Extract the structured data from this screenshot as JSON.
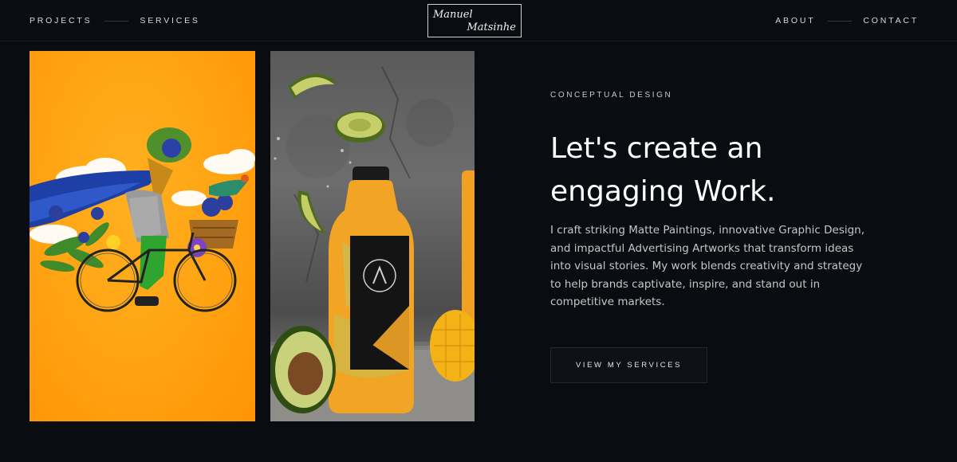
{
  "nav": {
    "left": [
      {
        "label": "PROJECTS"
      },
      {
        "label": "SERVICES"
      }
    ],
    "right": [
      {
        "label": "ABOUT"
      },
      {
        "label": "CONTACT"
      }
    ]
  },
  "logo": {
    "line1": "Manuel",
    "line2": "Matsinhe"
  },
  "gallery": {
    "image1": "illustration-cyclist-with-flowers",
    "image2": "juice-bottle-avocado"
  },
  "hero": {
    "eyebrow": "CONCEPTUAL DESIGN",
    "headline_line1": "Let's create an",
    "headline_line2": "engaging Work.",
    "body": "I craft striking Matte Paintings, innovative Graphic Design, and impactful Advertising Artworks that transform ideas into visual stories. My work blends creativity and strategy to help brands captivate, inspire, and stand out in competitive markets.",
    "cta_label": "VIEW MY SERVICES"
  },
  "colors": {
    "background": "#090c10",
    "accent_orange": "#ffa514",
    "text": "#ffffff"
  }
}
